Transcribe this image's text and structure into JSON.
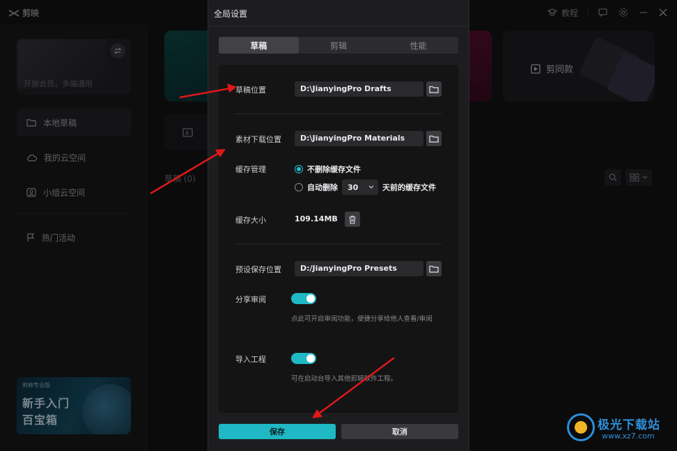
{
  "app": {
    "title": "剪映",
    "titlebar": {
      "tutorial_label": "教程"
    },
    "sidebar": {
      "user_text": "开放会员，多端通用",
      "items": [
        {
          "label": "本地草稿",
          "icon": "folder-icon"
        },
        {
          "label": "我的云空间",
          "icon": "cloud-icon"
        },
        {
          "label": "小组云空间",
          "icon": "group-icon"
        },
        {
          "label": "热门活动",
          "icon": "flag-icon"
        }
      ],
      "promo": {
        "small": "剪映专业版",
        "line1": "新手入门",
        "line2": "百宝箱"
      }
    },
    "main": {
      "template_card": "剪同款",
      "drafts_title": "草稿 (0)"
    }
  },
  "dialog": {
    "title": "全局设置",
    "tabs": [
      "草稿",
      "剪辑",
      "性能"
    ],
    "active_tab": 0,
    "draft_location": {
      "label": "草稿位置",
      "value": "D:\\JianyingPro Drafts"
    },
    "material_location": {
      "label": "素材下载位置",
      "value": "D:\\JianyingPro Materials"
    },
    "cache": {
      "label": "缓存管理",
      "option_keep": "不删除缓存文件",
      "option_auto_prefix": "自动删除",
      "days": "30",
      "option_auto_suffix": "天前的缓存文件",
      "selected": "keep"
    },
    "cache_size": {
      "label": "缓存大小",
      "value": "109.14MB"
    },
    "preset_location": {
      "label": "预设保存位置",
      "value": "D:/JianyingPro Presets"
    },
    "share_review": {
      "label": "分享审阅",
      "enabled": true,
      "hint": "点此可开启审阅功能，便捷分享给他人查看/审阅"
    },
    "import_project": {
      "label": "导入工程",
      "enabled": true,
      "hint": "可在启动台导入其他剪辑软件工程。"
    },
    "save_label": "保存",
    "cancel_label": "取消"
  },
  "colors": {
    "accent": "#1fb8c4",
    "annotation": "#e01818"
  },
  "watermark": {
    "line1": "极光下载站",
    "line2": "www.xz7.com"
  }
}
